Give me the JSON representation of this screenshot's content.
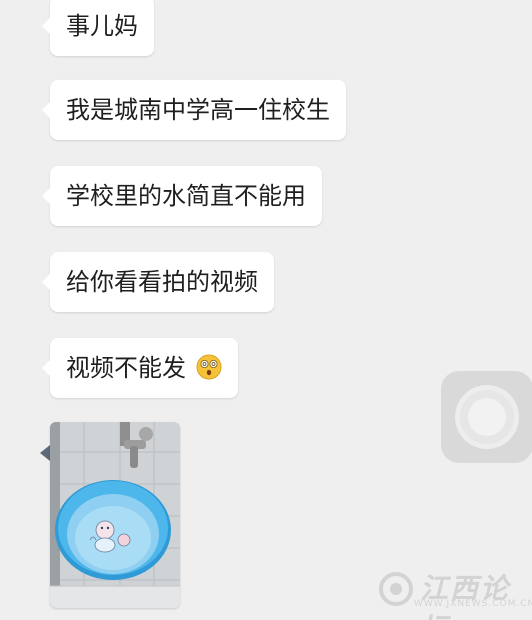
{
  "messages": [
    {
      "text": "事儿妈"
    },
    {
      "text": "我是城南中学高一住校生"
    },
    {
      "text": "学校里的水简直不能用"
    },
    {
      "text": "给你看看拍的视频"
    },
    {
      "text": "视频不能发",
      "emoji": "shocked-face-emoji"
    }
  ],
  "photo": {
    "description_icon": "washbasin-photo"
  },
  "assistive_button": {
    "icon": "assistive-touch-icon"
  },
  "watermark": {
    "text": "江西论坛",
    "url": "WWW.JXNEWS.COM.CN"
  }
}
